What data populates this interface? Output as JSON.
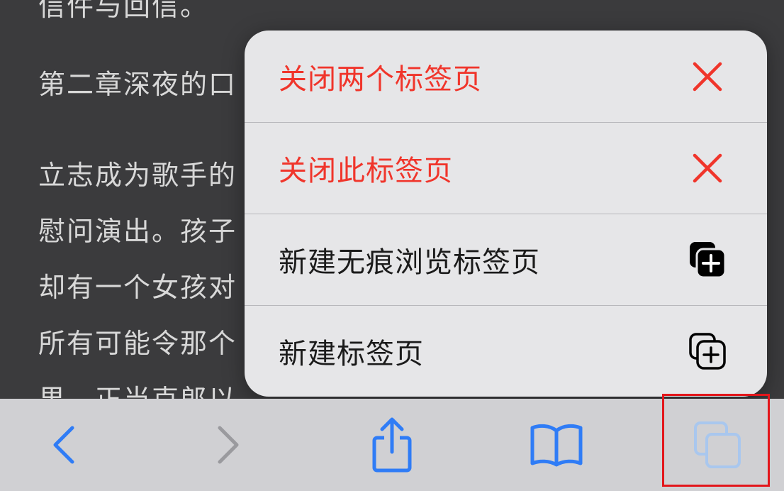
{
  "article": {
    "lines": [
      "信件与回信。",
      "第二章深夜的口",
      "立志成为歌手的",
      "慰问演出。孩子",
      "却有一个女孩对",
      "所有可能令那个",
      "果。正当克郎以"
    ]
  },
  "menu": {
    "items": [
      {
        "label": "关闭两个标签页",
        "icon": "close-x-icon",
        "style": "destructive"
      },
      {
        "label": "关闭此标签页",
        "icon": "close-x-icon",
        "style": "destructive"
      },
      {
        "label": "新建无痕浏览标签页",
        "icon": "private-tab-plus-icon",
        "style": "normal"
      },
      {
        "label": "新建标签页",
        "icon": "new-tab-plus-icon",
        "style": "normal"
      }
    ]
  },
  "toolbar": {
    "buttons": [
      {
        "name": "back",
        "icon": "chevron-left-icon",
        "enabled": true
      },
      {
        "name": "forward",
        "icon": "chevron-right-icon",
        "enabled": false
      },
      {
        "name": "share",
        "icon": "share-icon",
        "enabled": true
      },
      {
        "name": "bookmarks",
        "icon": "book-icon",
        "enabled": true
      },
      {
        "name": "tabs",
        "icon": "tabs-icon",
        "enabled": true,
        "highlighted": true
      }
    ]
  },
  "colors": {
    "accent": "#2f7cf6",
    "destructive": "#f0352b",
    "disabled": "#9a9a9e",
    "highlight": "#e3161b"
  }
}
